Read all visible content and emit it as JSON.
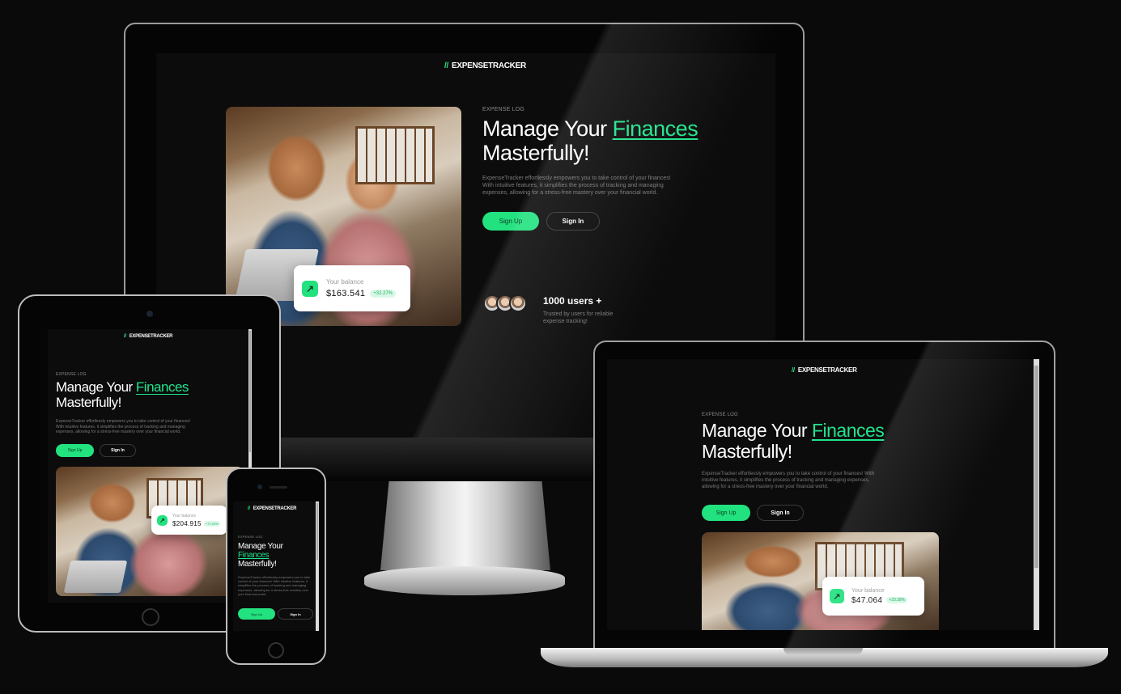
{
  "brand": {
    "name": "EXPENSETRACKER",
    "logo_glyph": "∕∕"
  },
  "hero": {
    "eyebrow": "EXPENSE LOG",
    "headline_prefix": "Manage Your ",
    "headline_accent": "Finances",
    "headline_suffix": "Masterfully!",
    "description": "ExpenseTracker effortlessly empowers you to take control of your finances! With intuitive features, it simplifies the process of tracking and managing expenses, allowing for a stress-free mastery over your financial world.",
    "signup_label": "Sign Up",
    "signin_label": "Sign In"
  },
  "balance_card": {
    "label": "Your balance",
    "desktop": {
      "amount": "$163.541",
      "change": "+32.27%"
    },
    "tablet": {
      "amount": "$204.915",
      "change": "+71.05%"
    },
    "laptop": {
      "amount": "$47.064",
      "change": "+33.38%"
    }
  },
  "users": {
    "count_label": "1000 users +",
    "caption": "Trusted by users for reliable expense tracking!"
  },
  "colors": {
    "accent": "#22e27f",
    "background": "#0c0c0c"
  },
  "icons": {
    "arrow": "up-right-arrow-icon",
    "logo": "logo-icon"
  }
}
